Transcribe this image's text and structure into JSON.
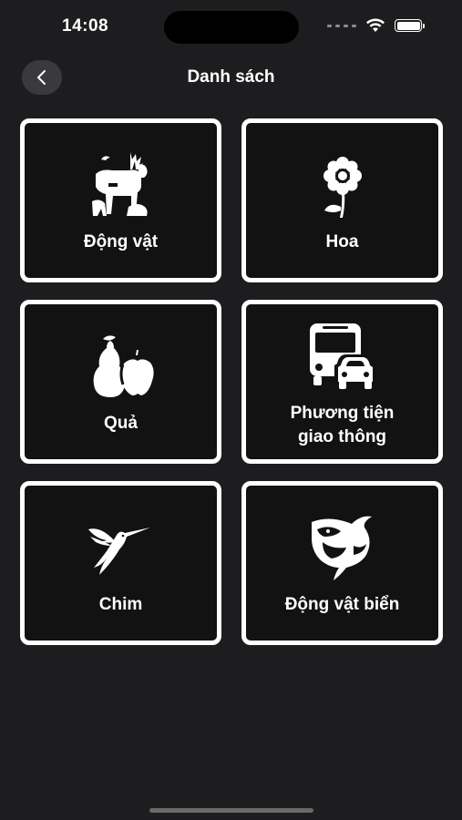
{
  "status_bar": {
    "time": "14:08"
  },
  "nav": {
    "title": "Danh sách"
  },
  "categories": [
    {
      "label": "Động vật",
      "icon": "animals-icon"
    },
    {
      "label": "Hoa",
      "icon": "flower-icon"
    },
    {
      "label": "Quả",
      "icon": "fruit-icon"
    },
    {
      "label": "Phương tiện\ngiao thông",
      "icon": "vehicle-icon"
    },
    {
      "label": "Chim",
      "icon": "bird-icon"
    },
    {
      "label": "Động vật biển",
      "icon": "orca-icon"
    }
  ],
  "colors": {
    "background": "#1d1d1f",
    "card": "#121212",
    "border": "#ffffff",
    "text": "#ffffff"
  }
}
